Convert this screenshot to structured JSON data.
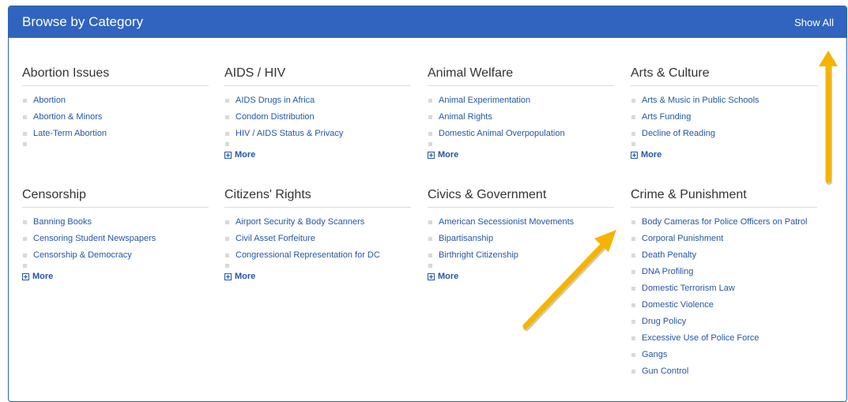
{
  "header": {
    "title": "Browse by Category",
    "show_all": "Show All"
  },
  "more_label": "More",
  "categories": [
    {
      "title": "Abortion Issues",
      "items": [
        "Abortion",
        "Abortion & Minors",
        "Late-Term Abortion"
      ]
    },
    {
      "title": "AIDS / HIV",
      "items": [
        "AIDS Drugs in Africa",
        "Condom Distribution",
        "HIV / AIDS Status & Privacy"
      ]
    },
    {
      "title": "Animal Welfare",
      "items": [
        "Animal Experimentation",
        "Animal Rights",
        "Domestic Animal Overpopulation"
      ]
    },
    {
      "title": "Arts & Culture",
      "items": [
        "Arts & Music in Public Schools",
        "Arts Funding",
        "Decline of Reading"
      ]
    },
    {
      "title": "Censorship",
      "items": [
        "Banning Books",
        "Censoring Student Newspapers",
        "Censorship & Democracy"
      ]
    },
    {
      "title": "Citizens' Rights",
      "items": [
        "Airport Security & Body Scanners",
        "Civil Asset Forfeiture",
        "Congressional Representation for DC"
      ]
    },
    {
      "title": "Civics & Government",
      "items": [
        "American Secessionist Movements",
        "Bipartisanship",
        "Birthright Citizenship"
      ]
    },
    {
      "title": "Crime & Punishment",
      "items": [
        "Body Cameras for Police Officers on Patrol",
        "Corporal Punishment",
        "Death Penalty",
        "DNA Profiling",
        "Domestic Terrorism Law",
        "Domestic Violence",
        "Drug Policy",
        "Excessive Use of Police Force",
        "Gangs",
        "Gun Control"
      ]
    }
  ],
  "annotation_color": "#f5b400",
  "header_color": "#3164be"
}
